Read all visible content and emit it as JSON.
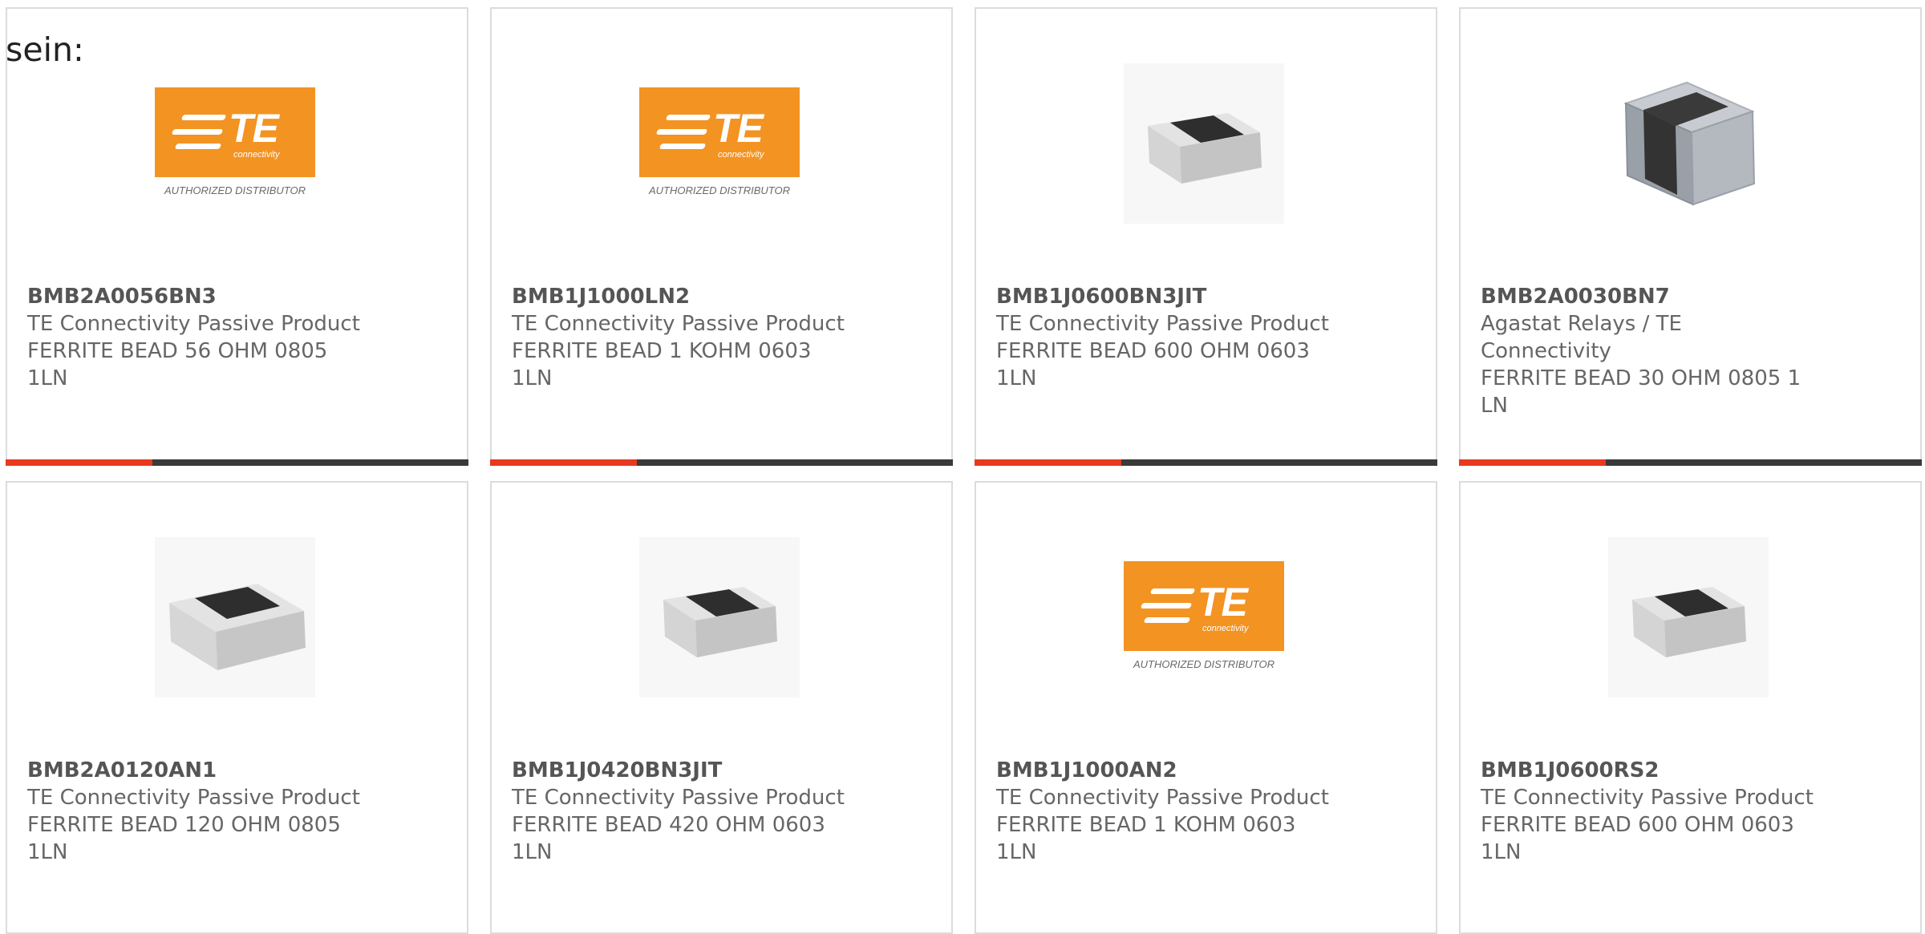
{
  "intro_text": "sein:",
  "brand": {
    "logo_text": "TE",
    "logo_subtext": "connectivity",
    "logo_caption": "AUTHORIZED DISTRIBUTOR",
    "orange": "#f39322",
    "accent_red": "#e8391e",
    "bar_dark": "#3a3a3a"
  },
  "products": [
    {
      "part": "BMB2A0056BN3",
      "manufacturer": "TE Connectivity Passive Product",
      "description": "FERRITE BEAD 56 OHM 0805 1LN",
      "image": "te-logo"
    },
    {
      "part": "BMB1J1000LN2",
      "manufacturer": "TE Connectivity Passive Product",
      "description": "FERRITE BEAD 1 KOHM 0603 1LN",
      "image": "te-logo"
    },
    {
      "part": "BMB1J0600BN3JIT",
      "manufacturer": "TE Connectivity Passive Product",
      "description": "FERRITE BEAD 600 OHM 0603 1LN",
      "image": "chip-small"
    },
    {
      "part": "BMB2A0030BN7",
      "manufacturer": "Agastat Relays / TE Connectivity",
      "description": "FERRITE BEAD 30 OHM 0805 1 LN",
      "image": "chip-rounded"
    },
    {
      "part": "BMB2A0120AN1",
      "manufacturer": "TE Connectivity Passive Product",
      "description": "FERRITE BEAD 120 OHM 0805 1LN",
      "image": "chip-large"
    },
    {
      "part": "BMB1J0420BN3JIT",
      "manufacturer": "TE Connectivity Passive Product",
      "description": "FERRITE BEAD 420 OHM 0603 1LN",
      "image": "chip-small"
    },
    {
      "part": "BMB1J1000AN2",
      "manufacturer": "TE Connectivity Passive Product",
      "description": "FERRITE BEAD 1 KOHM 0603 1LN",
      "image": "te-logo"
    },
    {
      "part": "BMB1J0600RS2",
      "manufacturer": "TE Connectivity Passive Product",
      "description": "FERRITE BEAD 600 OHM 0603 1LN",
      "image": "chip-small"
    }
  ]
}
